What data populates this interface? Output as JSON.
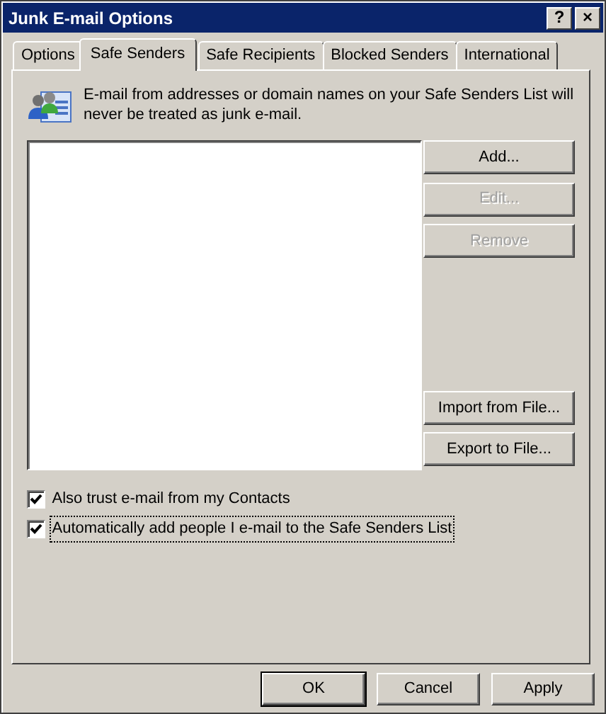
{
  "window": {
    "title": "Junk E-mail Options",
    "title_buttons": [
      "?",
      "×"
    ]
  },
  "tabs": [
    {
      "label": "Options",
      "selected": false
    },
    {
      "label": "Safe Senders",
      "selected": true
    },
    {
      "label": "Safe Recipients",
      "selected": false
    },
    {
      "label": "Blocked Senders",
      "selected": false
    },
    {
      "label": "International",
      "selected": false
    }
  ],
  "description": "E-mail from addresses or domain names on your Safe Senders List will never be treated as junk e-mail.",
  "list_buttons": [
    {
      "label": "Add...",
      "disabled": false
    },
    {
      "label": "Edit...",
      "disabled": true
    },
    {
      "label": "Remove",
      "disabled": true
    }
  ],
  "file_buttons": [
    {
      "label": "Import from File...",
      "disabled": false
    },
    {
      "label": "Export to File...",
      "disabled": false
    }
  ],
  "options": [
    {
      "label": "Also trust e-mail from my Contacts",
      "checked": true,
      "focused": false
    },
    {
      "label": "Automatically add people I e-mail to the Safe Senders List",
      "checked": true,
      "focused": true
    }
  ],
  "buttons": [
    {
      "label": "OK",
      "default": true
    },
    {
      "label": "Cancel",
      "default": false
    },
    {
      "label": "Apply",
      "default": false
    }
  ]
}
